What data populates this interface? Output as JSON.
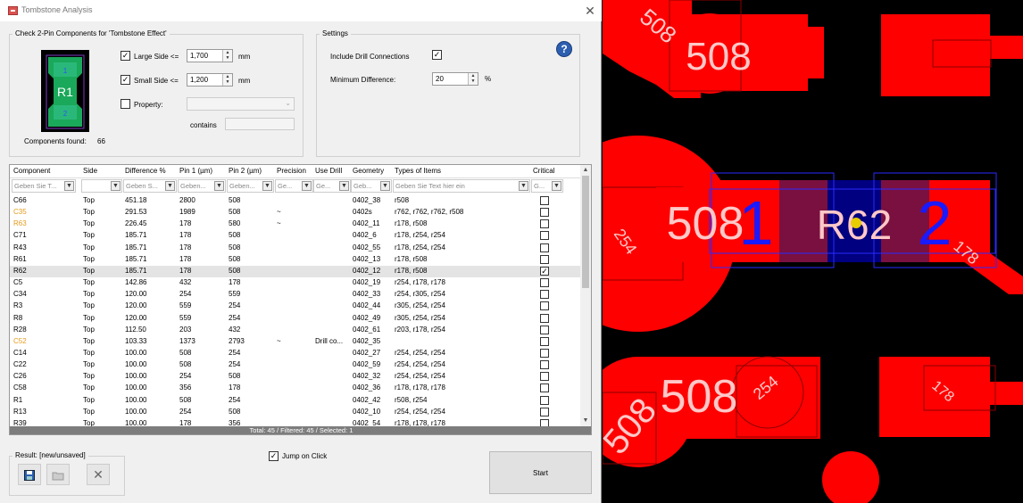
{
  "window": {
    "title": "Tombstone Analysis",
    "close": "✕"
  },
  "check_group": {
    "title": "Check 2-Pin Components for 'Tombstone Effect'",
    "large_side": {
      "label": "Large Side <=",
      "value": "1,700",
      "unit": "mm",
      "checked": "✓"
    },
    "small_side": {
      "label": "Small Side <=",
      "value": "1,200",
      "unit": "mm",
      "checked": "✓"
    },
    "property": {
      "label": "Property:",
      "checked": ""
    },
    "contains_label": "contains",
    "components_found_label": "Components found:",
    "components_found_value": "66",
    "thumb_label": "R1",
    "thumb_pin1": "1",
    "thumb_pin2": "2"
  },
  "settings_group": {
    "title": "Settings",
    "include_drill": {
      "label": "Include Drill Connections",
      "checked": "✓"
    },
    "min_diff": {
      "label": "Minimum Difference:",
      "value": "20",
      "unit": "%"
    },
    "help": "?"
  },
  "grid": {
    "columns": [
      "Component",
      "Side",
      "Difference %",
      "Pin 1 (µm)",
      "Pin 2 (µm)",
      "Precision",
      "Use Drill",
      "Geometry",
      "Types of Items",
      "Critical"
    ],
    "filters": [
      "Geben Sie T...",
      "",
      "Geben S...",
      "Geben...",
      "Geben...",
      "Ge...",
      "Ge...",
      "Geb...",
      "Geben Sie Text hier ein",
      "G..."
    ],
    "rows": [
      [
        "C66",
        "Top",
        "451.18",
        "2800",
        "508",
        "",
        "",
        "0402_38",
        "r508",
        ""
      ],
      [
        "C35",
        "Top",
        "291.53",
        "1989",
        "508",
        "~",
        "",
        "0402s",
        "r762, r762, r762, r508",
        ""
      ],
      [
        "R63",
        "Top",
        "226.45",
        "178",
        "580",
        "~",
        "",
        "0402_11",
        "r178, r508",
        ""
      ],
      [
        "C71",
        "Top",
        "185.71",
        "178",
        "508",
        "",
        "",
        "0402_6",
        "r178, r254, r254",
        ""
      ],
      [
        "R43",
        "Top",
        "185.71",
        "178",
        "508",
        "",
        "",
        "0402_55",
        "r178, r254, r254",
        ""
      ],
      [
        "R61",
        "Top",
        "185.71",
        "178",
        "508",
        "",
        "",
        "0402_13",
        "r178, r508",
        ""
      ],
      [
        "R62",
        "Top",
        "185.71",
        "178",
        "508",
        "",
        "",
        "0402_12",
        "r178, r508",
        "✓"
      ],
      [
        "C5",
        "Top",
        "142.86",
        "432",
        "178",
        "",
        "",
        "0402_19",
        "r254, r178, r178",
        ""
      ],
      [
        "C34",
        "Top",
        "120.00",
        "254",
        "559",
        "",
        "",
        "0402_33",
        "r254, r305, r254",
        ""
      ],
      [
        "R3",
        "Top",
        "120.00",
        "559",
        "254",
        "",
        "",
        "0402_44",
        "r305, r254, r254",
        ""
      ],
      [
        "R8",
        "Top",
        "120.00",
        "559",
        "254",
        "",
        "",
        "0402_49",
        "r305, r254, r254",
        ""
      ],
      [
        "R28",
        "Top",
        "112.50",
        "203",
        "432",
        "",
        "",
        "0402_61",
        "r203, r178, r254",
        ""
      ],
      [
        "C52",
        "Top",
        "103.33",
        "1373",
        "2793",
        "~",
        "Drill co...",
        "0402_35",
        "",
        ""
      ],
      [
        "C14",
        "Top",
        "100.00",
        "508",
        "254",
        "",
        "",
        "0402_27",
        "r254, r254, r254",
        ""
      ],
      [
        "C22",
        "Top",
        "100.00",
        "508",
        "254",
        "",
        "",
        "0402_59",
        "r254, r254, r254",
        ""
      ],
      [
        "C26",
        "Top",
        "100.00",
        "254",
        "508",
        "",
        "",
        "0402_32",
        "r254, r254, r254",
        ""
      ],
      [
        "C58",
        "Top",
        "100.00",
        "356",
        "178",
        "",
        "",
        "0402_36",
        "r178, r178, r178",
        ""
      ],
      [
        "R1",
        "Top",
        "100.00",
        "508",
        "254",
        "",
        "",
        "0402_42",
        "r508, r254",
        ""
      ],
      [
        "R13",
        "Top",
        "100.00",
        "254",
        "508",
        "",
        "",
        "0402_10",
        "r254, r254, r254",
        ""
      ],
      [
        "R39",
        "Top",
        "100.00",
        "178",
        "356",
        "",
        "",
        "0402_54",
        "r178, r178, r178",
        ""
      ]
    ],
    "orange_components": [
      "C35",
      "R63",
      "C52"
    ],
    "status": "Total: 45 / Filtered: 45 / Selected: 1"
  },
  "result": {
    "label": "Result: [new/unsaved]"
  },
  "jump_on_click": {
    "label": "Jump on Click",
    "checked": "✓"
  },
  "start_label": "Start",
  "pcb": {
    "labels_508": "508",
    "label_254": "254",
    "label_178": "178",
    "pin1": "1",
    "pin2": "2",
    "refdes": "R62"
  },
  "colors": {
    "pad": "#ff0000",
    "accent_orange": "#e69a1a",
    "pin_blue": "#1a1aff",
    "selection": "#000080"
  }
}
